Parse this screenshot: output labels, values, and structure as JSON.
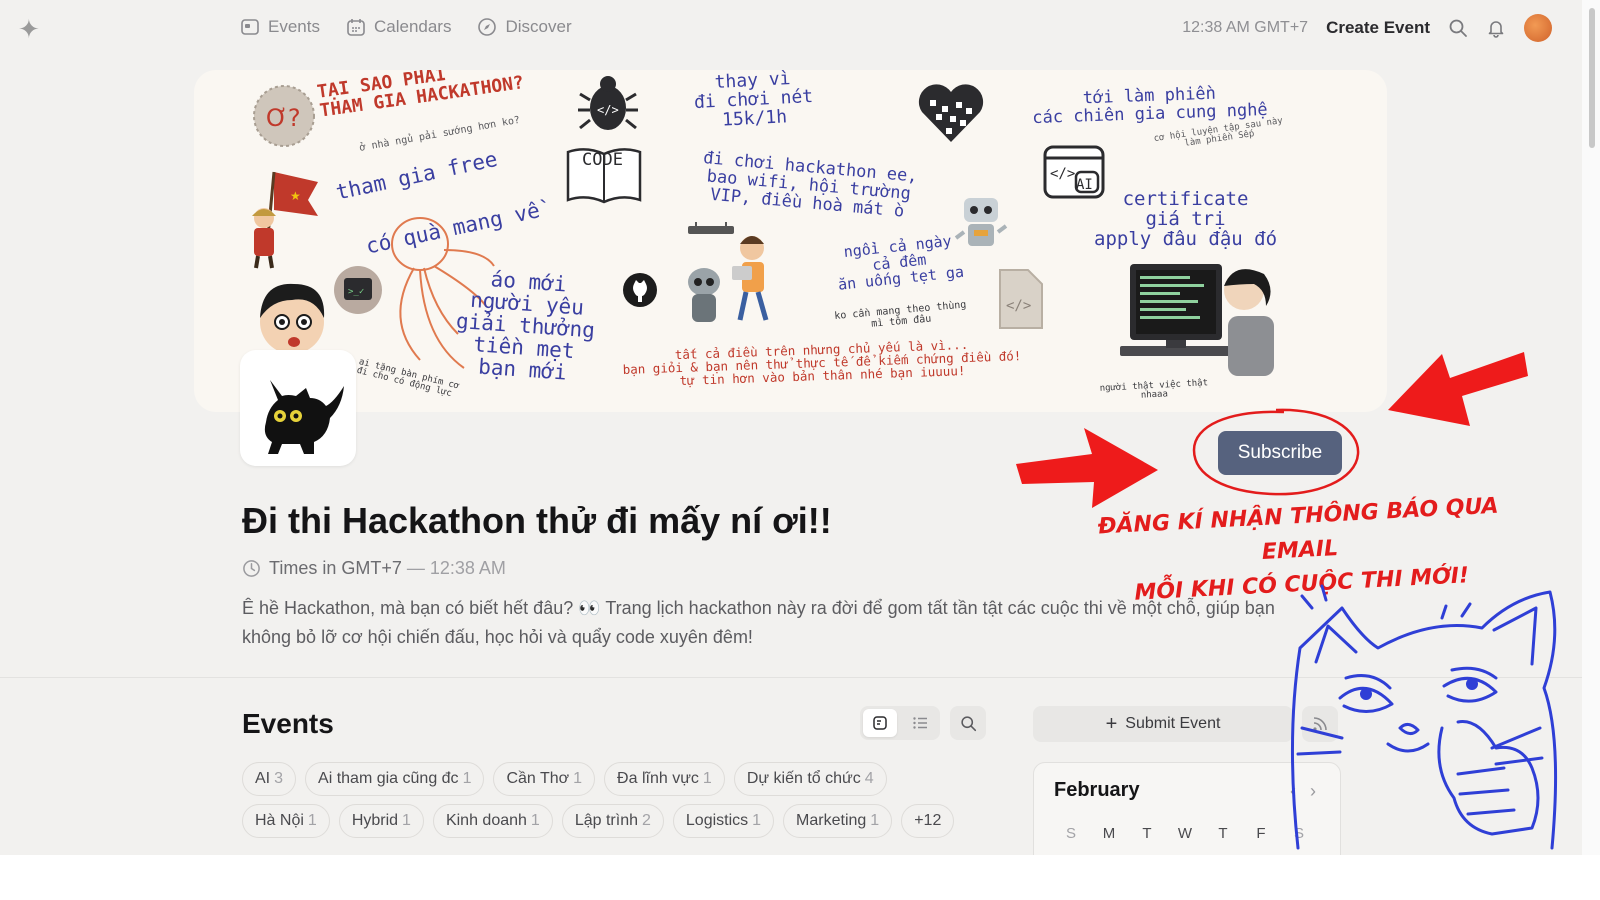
{
  "nav": {
    "logo": "✦",
    "links": [
      {
        "label": "Events",
        "icon": "events-icon"
      },
      {
        "label": "Calendars",
        "icon": "calendar-icon"
      },
      {
        "label": "Discover",
        "icon": "compass-icon"
      }
    ],
    "time": "12:38 AM GMT+7",
    "create_event": "Create Event"
  },
  "banner": {
    "t1": "TẠI SAO PHẢI\nTHAM GIA HACKATHON?",
    "t2": "ở nhà ngủ pải sướng hơn ko?",
    "t3": "thay vì\nđi chơi nét\n15k/1h",
    "t4": "tới làm phiền\ncác chiên gia cung nghệ",
    "t5": "cơ hội luyện tập sau này\nlàm phiền Sếp",
    "t6": "tham gia free",
    "t7": "có quà mang về",
    "t8": "đi chơi hackathon ee,\nbao wifi, hội trường\nVIP, điều hoà mát ò",
    "t9": "certificate\ngiá trị\napply đâu đậu đó",
    "t10": "áo mới\nngười yêu\ngiải thưởng\ntiền mẹt\nbạn mới",
    "t11": "ngồi cả ngày\ncả đêm\năn uống tẹt ga",
    "t12": "ko cần mang theo thùng\nmì tôm đâu",
    "t13": "tất cả điều trên nhưng chủ yếu là vì...\nbạn giỏi & bạn nên thử thực tế để kiếm chứng điều đó!\ntự tin hơn vào bản thân nhé bạn iuuuu!",
    "t14": "ai tặng bàn phím cơ\nđi cho có động lực",
    "t15": "người thật việc thật\nnhaaa",
    "code": "CODE",
    "ai": "AI"
  },
  "subscribe_label": "Subscribe",
  "annotation": {
    "line1": "ĐĂNG KÍ NHẬN THÔNG BÁO QUA EMAIL",
    "line2": "MỖI KHI CÓ CUỘC THI MỚI!"
  },
  "calendar": {
    "title": "Đi thi Hackathon thử đi mấy ní ơi!!",
    "timezone": "Times in GMT+7",
    "time_sep": " — ",
    "time": "12:38 AM",
    "description": "Ê hề Hackathon, mà bạn có biết hết đâu? 👀 Trang lịch hackathon này ra đời để gom tất tần tật các cuộc thi về một chỗ, giúp bạn không bỏ lỡ cơ hội chiến đấu, học hỏi và quẩy code xuyên đêm!"
  },
  "events": {
    "heading": "Events",
    "tags": [
      {
        "name": "AI",
        "count": "3"
      },
      {
        "name": "Ai tham gia cũng đc",
        "count": "1"
      },
      {
        "name": "Cần Thơ",
        "count": "1"
      },
      {
        "name": "Đa lĩnh vực",
        "count": "1"
      },
      {
        "name": "Dự kiến tổ chức",
        "count": "4"
      },
      {
        "name": "Hà Nội",
        "count": "1"
      },
      {
        "name": "Hybrid",
        "count": "1"
      },
      {
        "name": "Kinh doanh",
        "count": "1"
      },
      {
        "name": "Lập trình",
        "count": "2"
      },
      {
        "name": "Logistics",
        "count": "1"
      },
      {
        "name": "Marketing",
        "count": "1"
      },
      {
        "name": "+12",
        "count": ""
      }
    ],
    "submit_label": "Submit Event",
    "submit_icon": "+",
    "month": "February",
    "prev": "‹",
    "next": "›",
    "weekdays": [
      "S",
      "M",
      "T",
      "W",
      "T",
      "F",
      "S"
    ]
  },
  "colors": {
    "background": "#f2f1ef",
    "subscribe": "#56627e",
    "annotation_red": "#e31c1c",
    "doodle_blue": "#2f3fd6",
    "banner_text": "#3a3fa1"
  }
}
